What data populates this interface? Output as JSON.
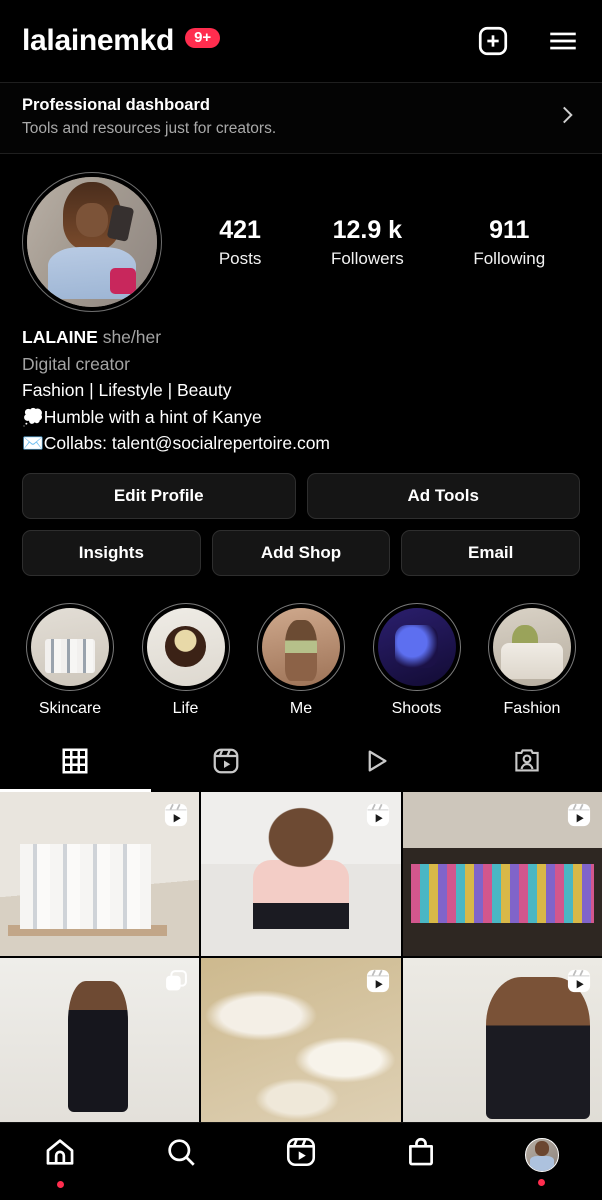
{
  "header": {
    "username": "lalainemkd",
    "notification_badge": "9+",
    "badge_color": "#FF2D4E",
    "create_icon": "plus-square-icon",
    "menu_icon": "hamburger-menu-icon"
  },
  "professional_dashboard": {
    "title": "Professional dashboard",
    "subtitle": "Tools and resources just for creators.",
    "chevron_icon": "chevron-right-icon"
  },
  "profile": {
    "avatar_alt": "profile-picture",
    "stats": [
      {
        "value": "421",
        "label": "Posts"
      },
      {
        "value": "12.9 k",
        "label": "Followers"
      },
      {
        "value": "911",
        "label": "Following"
      }
    ],
    "display_name": "LALAINE",
    "pronouns": "she/her",
    "category": "Digital creator",
    "bio_lines": [
      "Fashion | Lifestyle | Beauty",
      "💭Humble with a hint of Kanye",
      "✉️Collabs: talent@socialrepertoire.com"
    ]
  },
  "action_buttons": {
    "row1": [
      "Edit Profile",
      "Ad Tools"
    ],
    "row2": [
      "Insights",
      "Add Shop",
      "Email"
    ]
  },
  "highlights": [
    {
      "label": "Skincare"
    },
    {
      "label": "Life"
    },
    {
      "label": "Me"
    },
    {
      "label": "Shoots"
    },
    {
      "label": "Fashion"
    }
  ],
  "tabs": [
    {
      "icon": "grid-icon",
      "active": true
    },
    {
      "icon": "reels-icon",
      "active": false
    },
    {
      "icon": "play-triangle-icon",
      "active": false
    },
    {
      "icon": "tagged-person-icon",
      "active": false
    }
  ],
  "posts": [
    {
      "overlay_icon": "reels-icon"
    },
    {
      "overlay_icon": "reels-icon"
    },
    {
      "overlay_icon": "reels-icon"
    },
    {
      "overlay_icon": "carousel-icon"
    },
    {
      "overlay_icon": "reels-icon"
    },
    {
      "overlay_icon": "reels-icon"
    }
  ],
  "bottom_nav": [
    {
      "icon": "home-icon",
      "dot": true
    },
    {
      "icon": "search-icon",
      "dot": false
    },
    {
      "icon": "reels-icon",
      "dot": false
    },
    {
      "icon": "shop-bag-icon",
      "dot": false
    },
    {
      "icon": "profile-avatar-icon",
      "dot": true
    }
  ]
}
